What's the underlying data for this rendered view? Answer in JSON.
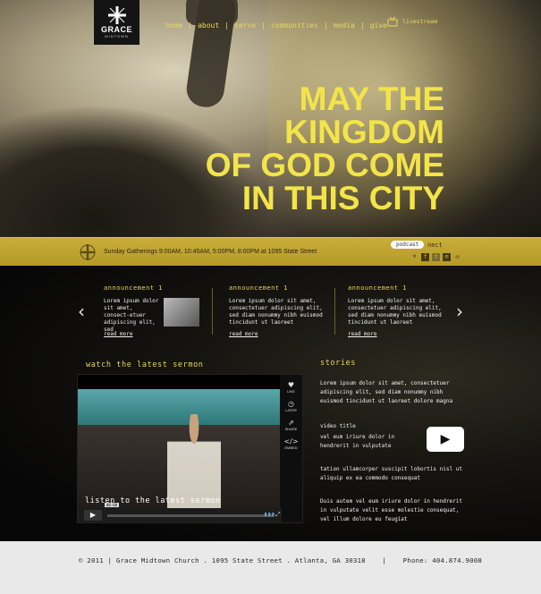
{
  "logo": {
    "line1": "GRACE",
    "line2": "MIDTOWN"
  },
  "nav": {
    "items": [
      {
        "label": "home"
      },
      {
        "label": "about"
      },
      {
        "label": "serve"
      },
      {
        "label": "communities"
      },
      {
        "label": "media"
      },
      {
        "label": "give"
      }
    ],
    "separator": "|",
    "livestream_label": "livestream"
  },
  "hero": {
    "headline": [
      "MAY THE",
      "KINGDOM",
      "OF GOD COME",
      "IN THIS CITY"
    ]
  },
  "infobar": {
    "gatherings": "Sunday Gatherings  9:00AM, 10:45AM, 5:00PM, 8:00PM at 1095 State Street",
    "podcast_tooltip": "podcast",
    "connect_label": "nect"
  },
  "announcements": [
    {
      "title": "announcement 1",
      "body": "Lorem ipsum dolor sit amet, consect-etuer adipiscing elit, sed",
      "more": "read more"
    },
    {
      "title": "announcement 1",
      "body": "Lorem ipsum dolor sit amet, consectetuer adipiscing elit, sed diam nonummy nibh euismod tincidunt ut laoreet",
      "more": "read more"
    },
    {
      "title": "announcement 1",
      "body": "Lorem ipsum dolor sit amet, consectetuer adipiscing elit, sed diam nonummy nibh euismod tincidunt ut laoreet",
      "more": "read more"
    }
  ],
  "sermon": {
    "title": "watch the latest sermon",
    "overlay": "listen to the latest sermon",
    "time": "00:00",
    "side": [
      "LIKE",
      "LATER",
      "SHARE",
      "EMBED"
    ]
  },
  "stories": {
    "title": "stories",
    "p1": "Lorem ipsum dolor sit amet, consectetuer adipiscing elit, sed diam nonummy nibh euismod tincidunt ut laoreet dolore magna",
    "video_title": "video title",
    "p2": "vel eum iriure dolor in hendrerit in vulputate",
    "p3": "tation ullamcorper suscipit lobortis nisl ut aliquip ex ea commodo consequat",
    "p4": " Duis autem vel eum iriure dolor in hendrerit in vulputate velit esse molestie consequat,  vel illum dolore eu feugiat"
  },
  "footer": {
    "text": "© 2011 | Grace Midtown Church . 1095 State Street . Atlanta, GA 30318    |    Phone: 404.874.9008"
  },
  "colors": {
    "accent": "#f3e44a",
    "nav": "#e9d75c",
    "bar": "#c4a932"
  }
}
